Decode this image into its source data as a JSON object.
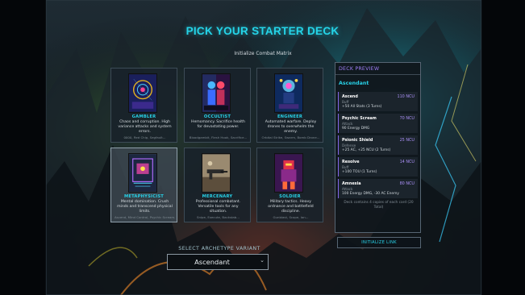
{
  "title": "PICK YOUR STARTER DECK",
  "subtitle": "Initialize Combat Matrix",
  "cards": [
    {
      "name": "GAMBLER",
      "desc": "Chaos and corruption. High variance attacks and system errors.",
      "tags": "0000, Red Chip, Segfault..."
    },
    {
      "name": "OCCULTIST",
      "desc": "Hemomancy. Sacrifice health for devastating power.",
      "tags": "Bloodgambit, Flesh Hook, Sacrifice..."
    },
    {
      "name": "ENGINEER",
      "desc": "Automated warfare. Deploy drones to overwhelm the enemy.",
      "tags": "Orbital Strike, Swarm, Bomb Drone..."
    },
    {
      "name": "METAPHYSICIST",
      "desc": "Mental domination. Crush minds and transcend physical limits.",
      "tags": "Ascend, Mind Control, Psychic Scream..."
    },
    {
      "name": "MERCENARY",
      "desc": "Professional combatant. Versatile tools for any situation.",
      "tags": "Snipe, Execute, Backstab..."
    },
    {
      "name": "SOLDIER",
      "desc": "Military tactics. Heavy ordnance and battlefield discipline.",
      "tags": "Gunblast, Scope, Ion..."
    }
  ],
  "preview": {
    "title": "DECK PREVIEW",
    "archetype": "Ascendant",
    "cards": [
      {
        "name": "Ascend",
        "cost": "110 NCU",
        "type": "Buff",
        "effect": "+50 All Stats (3 Turns)"
      },
      {
        "name": "Psychic Scream",
        "cost": "70 NCU",
        "type": "Attack",
        "effect": "90 Energy DMG"
      },
      {
        "name": "Psionic Shield",
        "cost": "25 NCU",
        "type": "Defense",
        "effect": "+25 AC, +25 NCU (2 Turns)"
      },
      {
        "name": "Resolve",
        "cost": "14 NCU",
        "type": "Buff",
        "effect": "+100 TOU (1 Turns)"
      },
      {
        "name": "Amnesia",
        "cost": "80 NCU",
        "type": "Attack",
        "effect": "100 Energy DMG, -30 AC Enemy"
      }
    ],
    "footer": "Deck contains 4 copies of each card (20 Total)"
  },
  "init_button": "INITIALIZE LINK",
  "select": {
    "label": "SELECT ARCHETYPE VARIANT",
    "value": "Ascendant"
  },
  "colors": {
    "accent_cyan": "#28d0e6",
    "accent_purple": "#9d7df4",
    "panel": "#19222a"
  },
  "icons": [
    "chevron-down-icon"
  ]
}
